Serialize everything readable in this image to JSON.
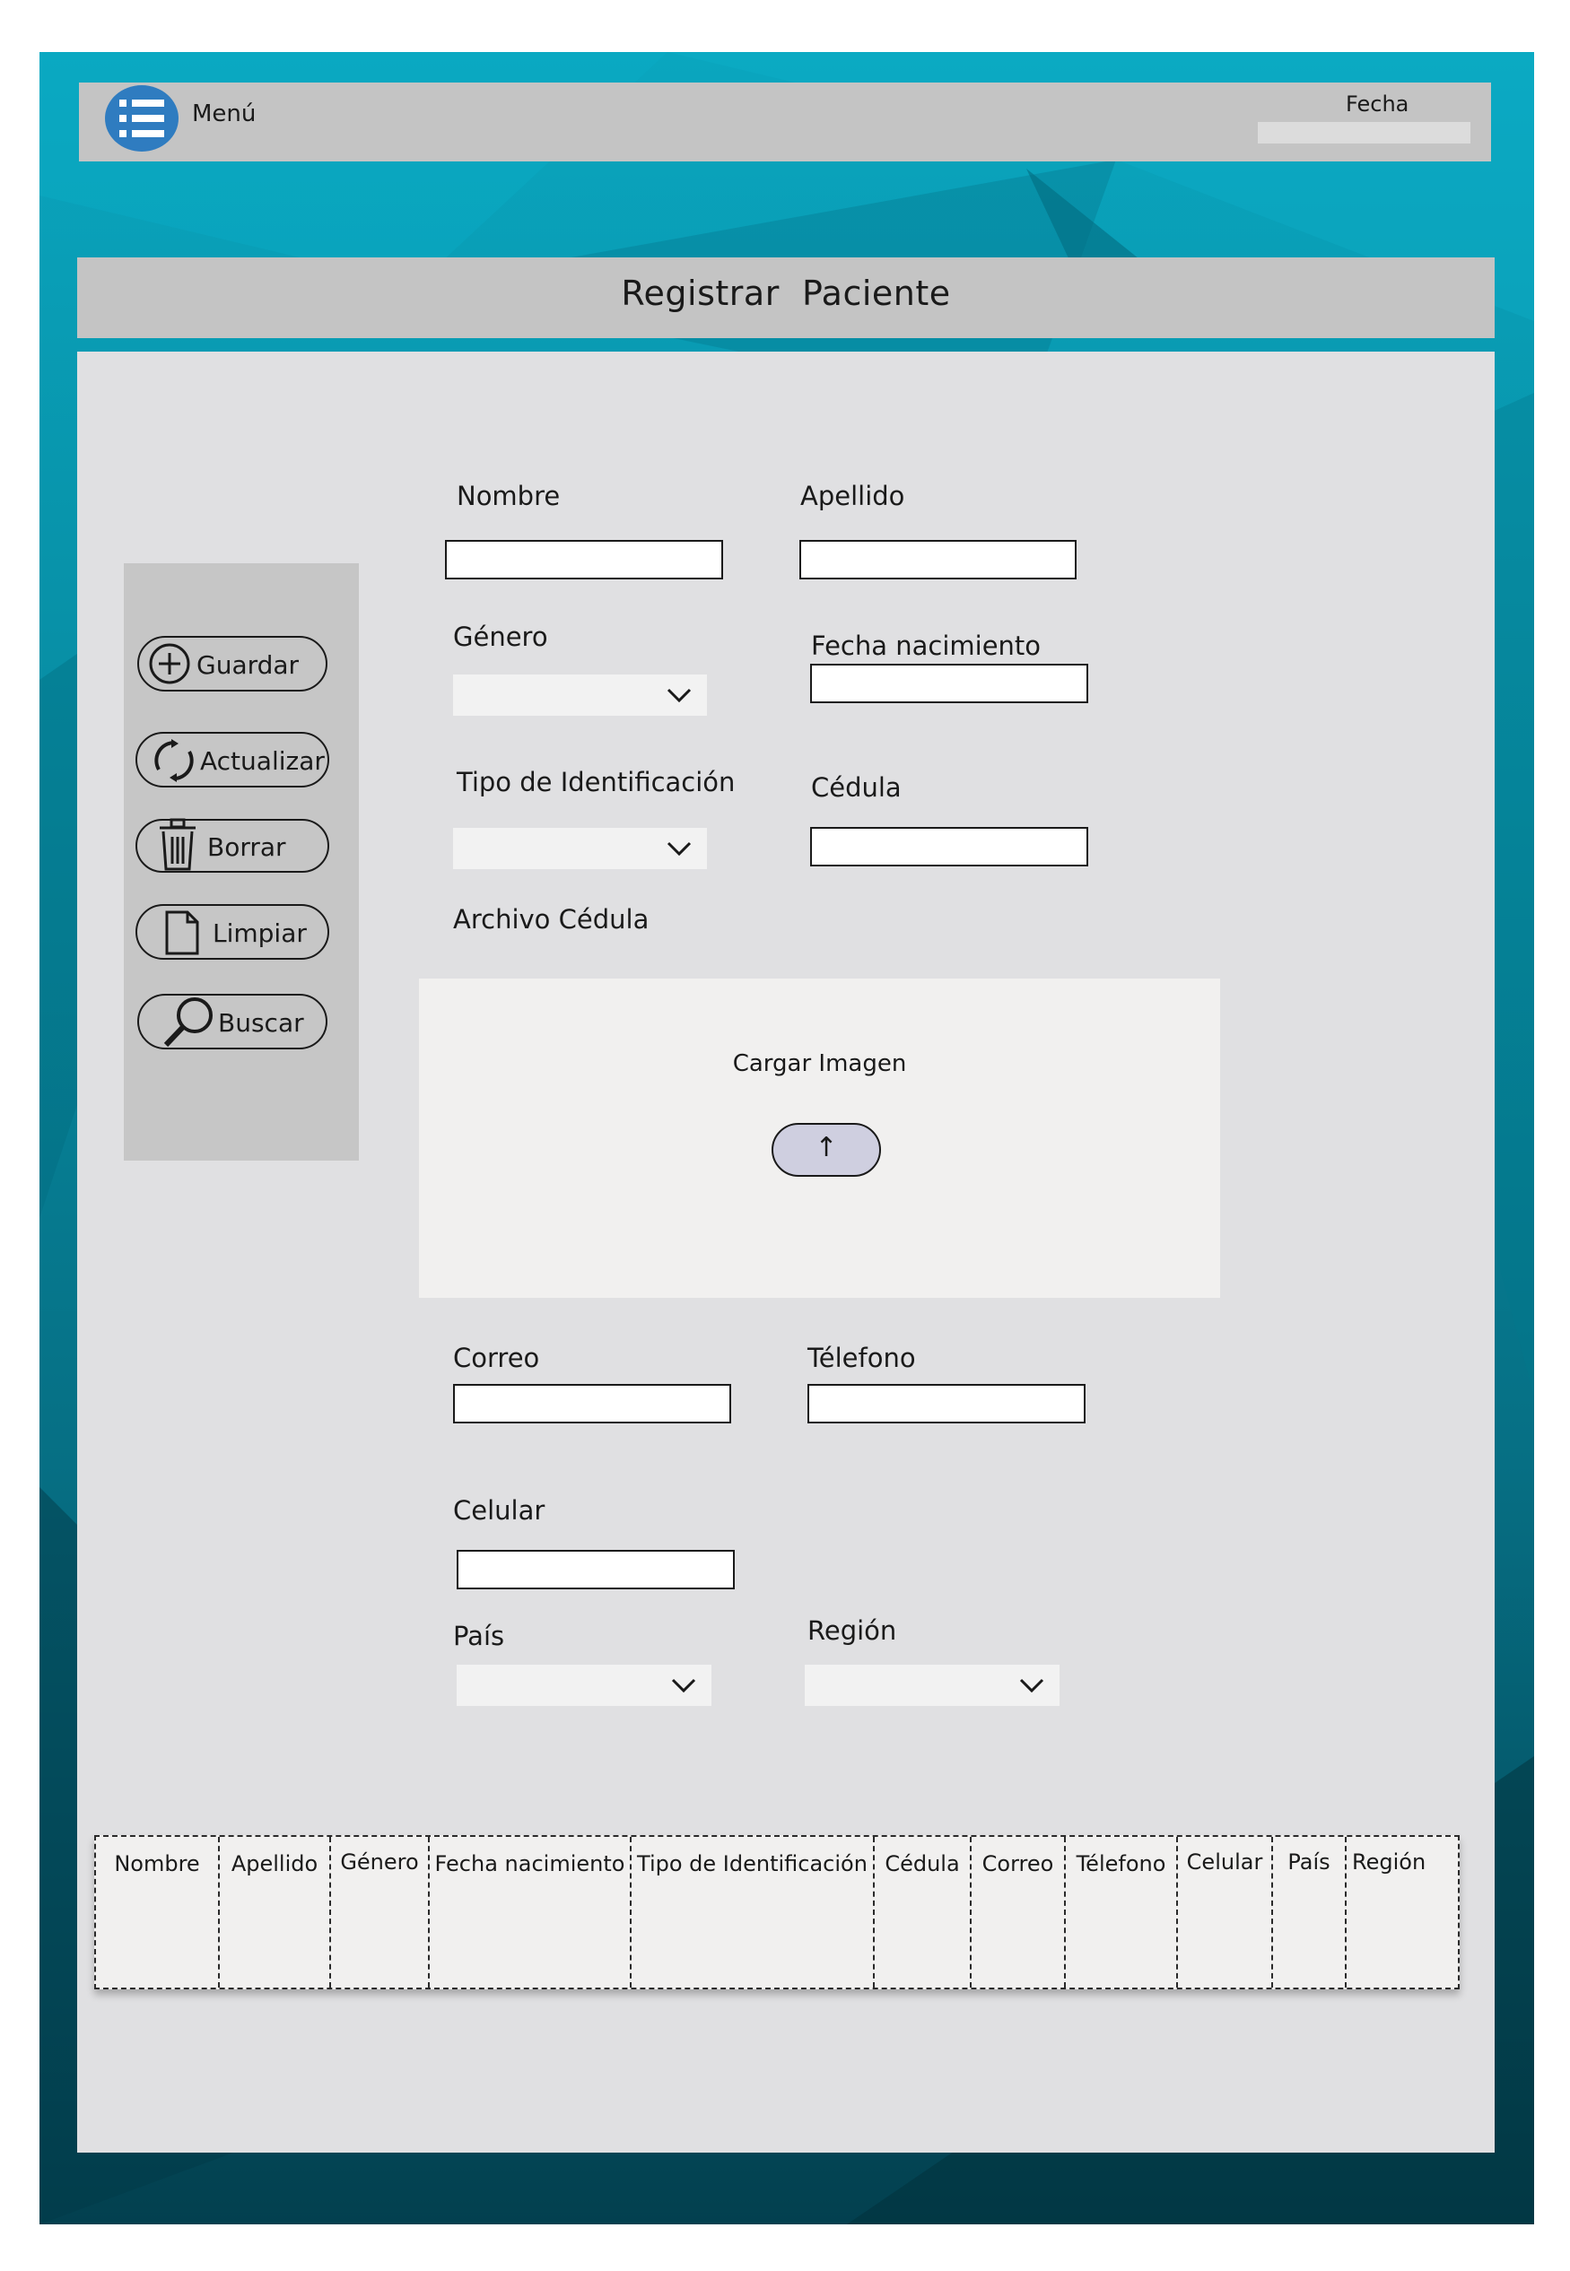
{
  "header": {
    "menu_label": "Menú",
    "menu_icon": "list-icon",
    "date_label": "Fecha",
    "date_value": ""
  },
  "title": "Registrar  Paciente",
  "sidebar": {
    "buttons": [
      {
        "label": "Guardar",
        "icon": "plus-circle-icon"
      },
      {
        "label": "Actualizar",
        "icon": "refresh-icon"
      },
      {
        "label": "Borrar",
        "icon": "trash-icon"
      },
      {
        "label": "Limpiar",
        "icon": "document-icon"
      },
      {
        "label": "Buscar",
        "icon": "magnifier-icon"
      }
    ]
  },
  "form": {
    "nombre_label": "Nombre",
    "apellido_label": "Apellido",
    "genero_label": "Género",
    "fecha_nacimiento_label": "Fecha nacimiento",
    "tipo_identificacion_label": "Tipo de Identificación",
    "cedula_label": "Cédula",
    "archivo_cedula_label": "Archivo Cédula",
    "upload_label": "Cargar Imagen",
    "upload_icon": "up-arrow-icon",
    "correo_label": "Correo",
    "telefono_label": "Télefono",
    "celular_label": "Celular",
    "pais_label": "País",
    "region_label": "Región"
  },
  "table": {
    "columns": [
      "Nombre",
      "Apellido",
      "Género",
      "Fecha nacimiento",
      "Tipo de Identificación",
      "Cédula",
      "Correo",
      "Télefono",
      "Celular",
      "País",
      "Región"
    ],
    "rows": []
  },
  "colors": {
    "background_teal": "#078aa0",
    "bar_gray": "#c4c4c4",
    "panel_gray": "#e0e0e2",
    "menu_icon_blue": "#2f7cc0",
    "upload_button": "#cfcfe0"
  }
}
